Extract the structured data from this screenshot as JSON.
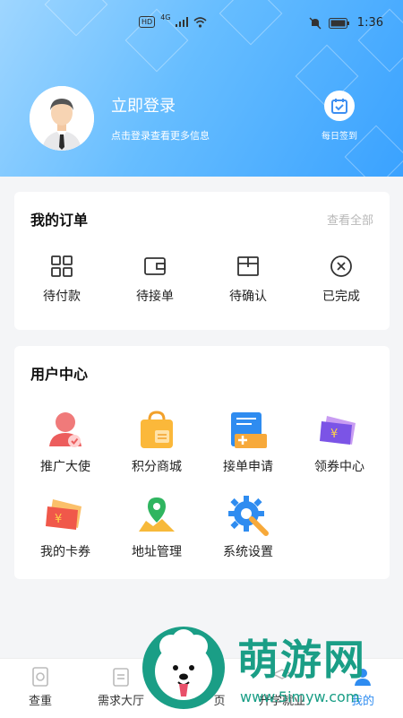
{
  "status_bar": {
    "hd": "HD",
    "network": "4G",
    "time": "1:36"
  },
  "header": {
    "login_title": "立即登录",
    "login_subtitle": "点击登录查看更多信息",
    "checkin_label": "每日签到"
  },
  "orders": {
    "title": "我的订单",
    "view_all": "查看全部",
    "items": [
      {
        "label": "待付款",
        "icon": "grid-icon"
      },
      {
        "label": "待接单",
        "icon": "wallet-icon"
      },
      {
        "label": "待确认",
        "icon": "box-icon"
      },
      {
        "label": "已完成",
        "icon": "circle-x-icon"
      }
    ]
  },
  "user_center": {
    "title": "用户中心",
    "items": [
      {
        "label": "推广大使",
        "icon": "promoter-icon"
      },
      {
        "label": "积分商城",
        "icon": "shopping-bag-icon"
      },
      {
        "label": "接单申请",
        "icon": "application-icon"
      },
      {
        "label": "领券中心",
        "icon": "coupon-icon"
      },
      {
        "label": "我的卡券",
        "icon": "ticket-icon"
      },
      {
        "label": "地址管理",
        "icon": "map-pin-icon"
      },
      {
        "label": "系统设置",
        "icon": "gear-icon"
      }
    ]
  },
  "tabbar": {
    "items": [
      {
        "label": "查重",
        "icon": "check-doc-icon"
      },
      {
        "label": "需求大厅",
        "icon": "clipboard-icon"
      },
      {
        "label": "页",
        "icon": "home-icon"
      },
      {
        "label": "升学就业",
        "icon": "grad-icon"
      },
      {
        "label": "我的",
        "icon": "user-icon"
      }
    ]
  },
  "watermark": {
    "brand": "萌游网",
    "url": "www.5imyw.com"
  },
  "colors": {
    "header_blue": "#3aa2ff",
    "accent": "#2f8cf0"
  }
}
